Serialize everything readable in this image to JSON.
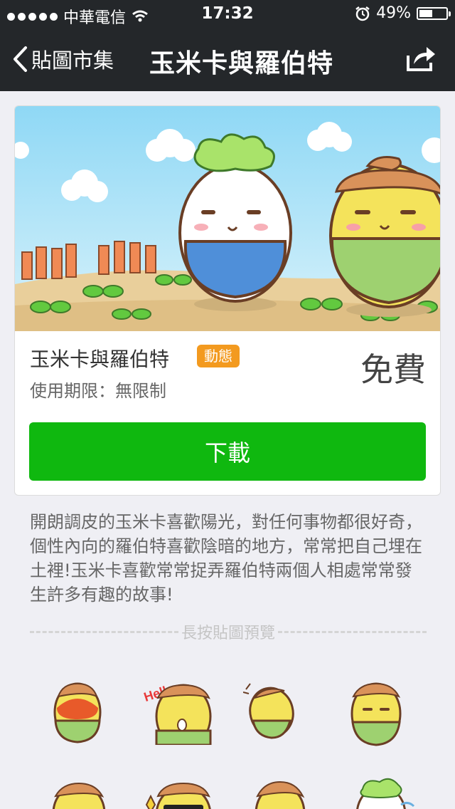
{
  "status_bar": {
    "carrier": "中華電信",
    "time": "17:32",
    "battery": "49%",
    "battery_level": 0.49
  },
  "nav": {
    "back_label": "貼圖市集",
    "title": "玉米卡與羅伯特",
    "back_icon": "chevron-left-icon",
    "share_icon": "share-icon"
  },
  "sticker": {
    "name": "玉米卡與羅伯特",
    "badge": "動態",
    "price": "免費",
    "validity": "使用期限：無限制",
    "download_label": "下載"
  },
  "description": "開朗調皮的玉米卡喜歡陽光，對任何事物都很好奇，個性內向的羅伯特喜歡陰暗的地方，常常把自己埋在土裡!玉米卡喜歡常常捉弄羅伯特兩個人相處常常發生許多有趣的故事!",
  "preview_hint": "長按貼圖預覽",
  "banner_art": "Hello",
  "colors": {
    "nav_bg": "#24272a",
    "download_green": "#0fb80f",
    "badge_orange": "#f39a1f"
  }
}
